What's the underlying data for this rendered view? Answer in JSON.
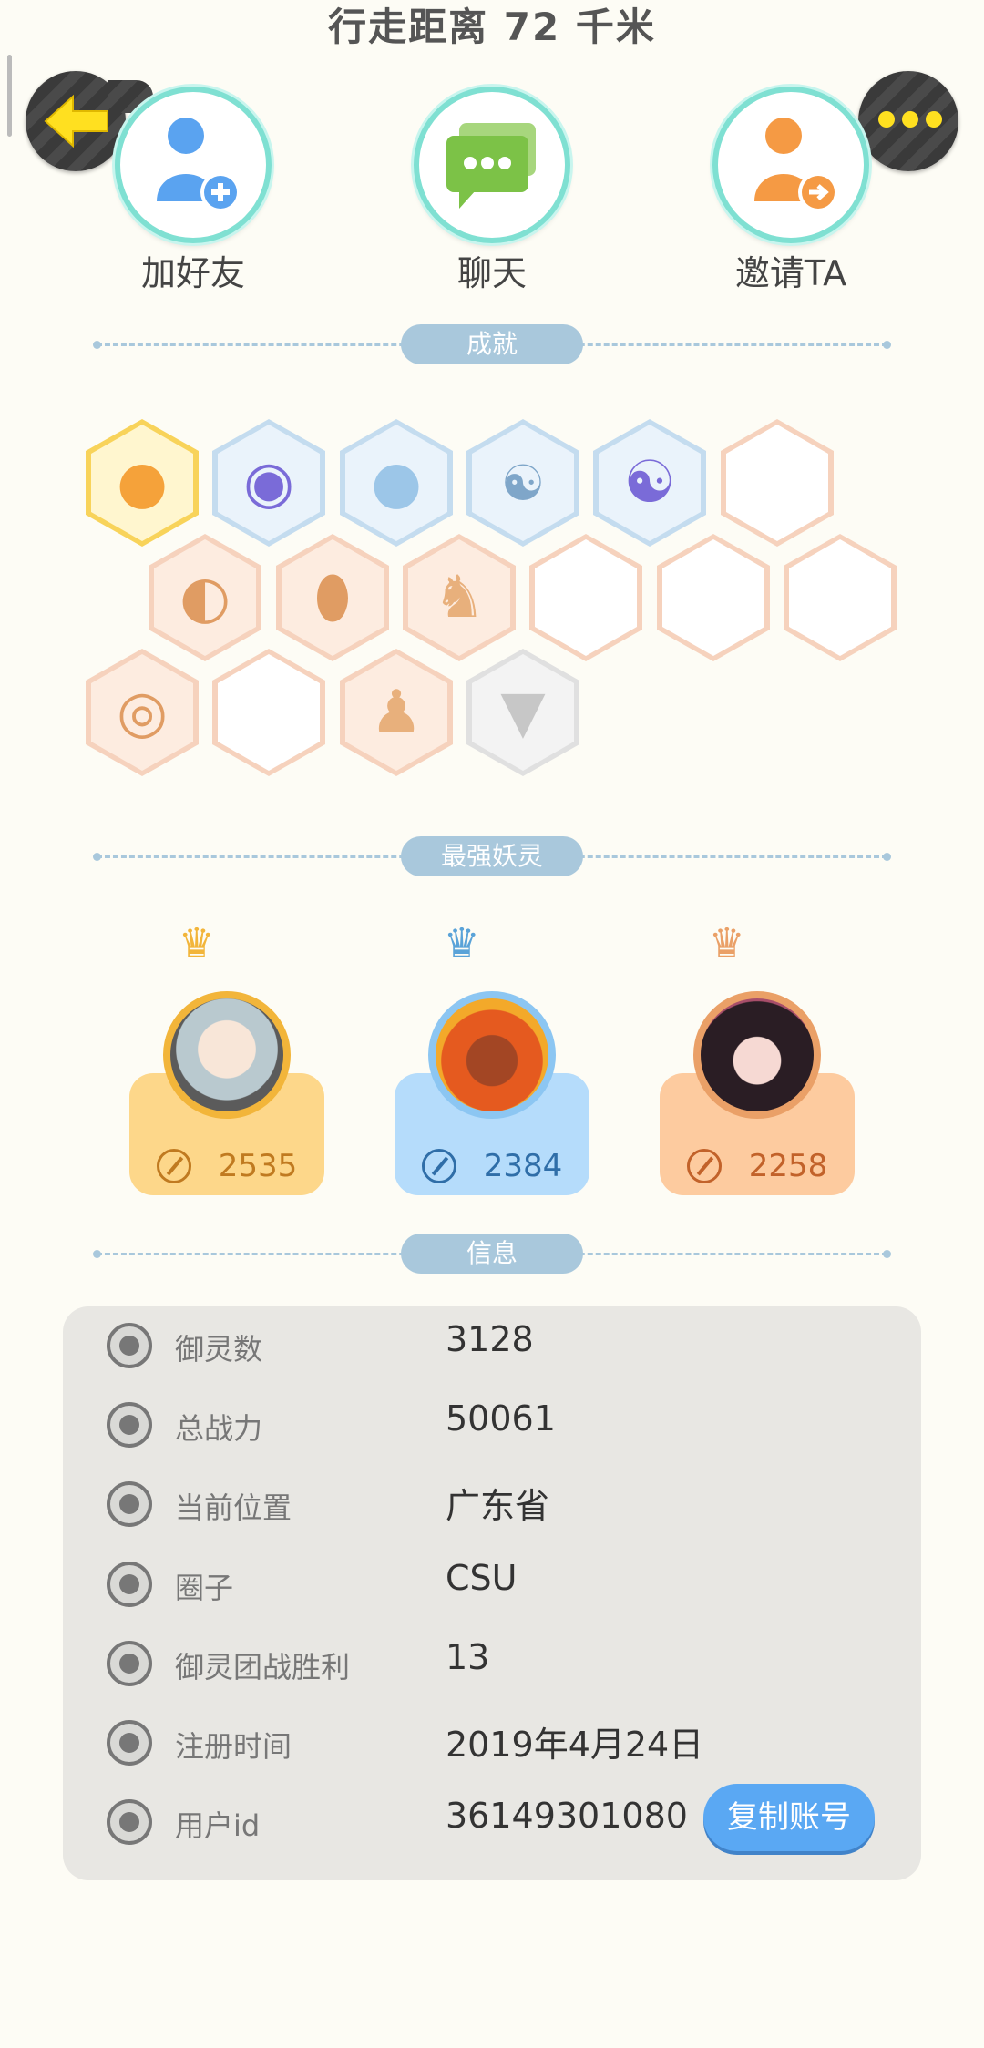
{
  "header": {
    "title": "行走距离 72 千米"
  },
  "nav": {
    "back_icon": "arrow-left-icon",
    "more_icon": "more-dots-icon"
  },
  "actions": [
    {
      "label": "加好友",
      "icon": "add-friend-icon"
    },
    {
      "label": "聊天",
      "icon": "chat-icon"
    },
    {
      "label": "邀请TA",
      "icon": "invite-icon"
    }
  ],
  "sections": {
    "achievements": "成就",
    "top_pets": "最强妖灵",
    "info": "信息"
  },
  "top_pets": [
    {
      "score": "2535",
      "crown_color": "#f2b53a"
    },
    {
      "score": "2384",
      "crown_color": "#5aa3d8"
    },
    {
      "score": "2258",
      "crown_color": "#eaa067"
    }
  ],
  "info": [
    {
      "key": "御灵数",
      "value": "3128",
      "icon": "pet-count-icon"
    },
    {
      "key": "总战力",
      "value": "50061",
      "icon": "sword-icon"
    },
    {
      "key": "当前位置",
      "value": "广东省",
      "icon": "location-pin-icon"
    },
    {
      "key": "圈子",
      "value": "CSU",
      "icon": "circle-icon"
    },
    {
      "key": "御灵团战胜利",
      "value": "13",
      "icon": "team-battle-icon"
    },
    {
      "key": "注册时间",
      "value": "2019年4月24日",
      "icon": "clock-icon"
    },
    {
      "key": "用户id",
      "value": "36149301080",
      "icon": "id-card-icon"
    }
  ],
  "copy_button": {
    "label": "复制账号"
  },
  "colors": {
    "accent_blue": "#5aa8f3",
    "section_pill": "#a9c8dc",
    "panel": "#e8e7e3"
  }
}
